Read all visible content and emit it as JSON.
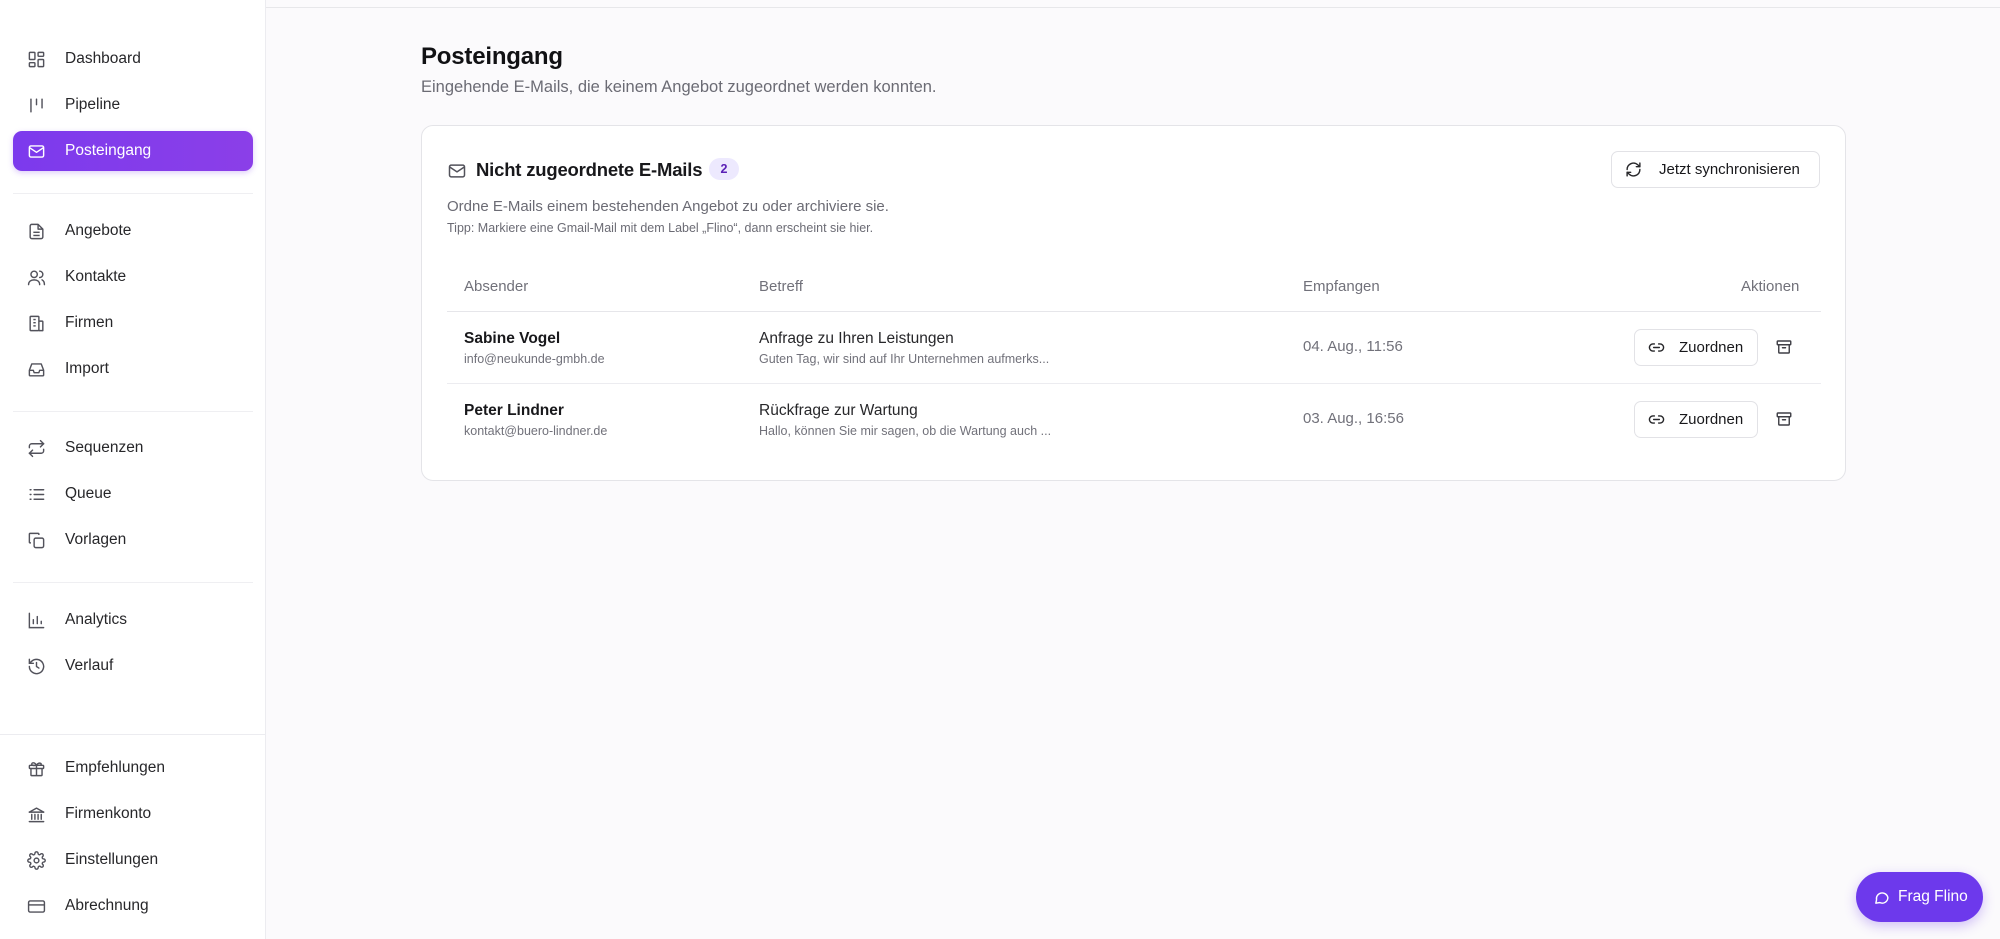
{
  "sidebar": {
    "items": [
      {
        "label": "Dashboard",
        "icon": "dashboard-icon"
      },
      {
        "label": "Pipeline",
        "icon": "pipeline-icon"
      },
      {
        "label": "Posteingang",
        "icon": "mail-icon",
        "active": true
      },
      {
        "label": "Angebote",
        "icon": "document-icon"
      },
      {
        "label": "Kontakte",
        "icon": "users-icon"
      },
      {
        "label": "Firmen",
        "icon": "building-icon"
      },
      {
        "label": "Import",
        "icon": "inbox-icon"
      },
      {
        "label": "Sequenzen",
        "icon": "repeat-icon"
      },
      {
        "label": "Queue",
        "icon": "list-icon"
      },
      {
        "label": "Vorlagen",
        "icon": "copy-icon"
      },
      {
        "label": "Analytics",
        "icon": "chart-icon"
      },
      {
        "label": "Verlauf",
        "icon": "history-icon"
      }
    ],
    "bottom_items": [
      {
        "label": "Empfehlungen",
        "icon": "gift-icon"
      },
      {
        "label": "Firmenkonto",
        "icon": "bank-icon"
      },
      {
        "label": "Einstellungen",
        "icon": "gear-icon"
      },
      {
        "label": "Abrechnung",
        "icon": "credit-card-icon"
      }
    ]
  },
  "page": {
    "title": "Posteingang",
    "subtitle": "Eingehende E-Mails, die keinem Angebot zugeordnet werden konnten."
  },
  "card": {
    "title": "Nicht zugeordnete E-Mails",
    "count": "2",
    "description": "Ordne E-Mails einem bestehenden Angebot zu oder archiviere sie.",
    "tip": "Tipp: Markiere eine Gmail-Mail mit dem Label „Flino“, dann erscheint sie hier.",
    "sync_label": "Jetzt synchronisieren"
  },
  "table": {
    "headers": {
      "sender": "Absender",
      "subject": "Betreff",
      "received": "Empfangen",
      "actions": "Aktionen"
    },
    "rows": [
      {
        "sender_name": "Sabine Vogel",
        "sender_email": "info@neukunde-gmbh.de",
        "subject": "Anfrage zu Ihren Leistungen",
        "preview": "Guten Tag, wir sind auf Ihr Unternehmen aufmerks...",
        "received": "04. Aug., 11:56",
        "assign_label": "Zuordnen"
      },
      {
        "sender_name": "Peter Lindner",
        "sender_email": "kontakt@buero-lindner.de",
        "subject": "Rückfrage zur Wartung",
        "preview": "Hallo, können Sie mir sagen, ob die Wartung auch ...",
        "received": "03. Aug., 16:56",
        "assign_label": "Zuordnen"
      }
    ]
  },
  "chat": {
    "label": "Frag Flino"
  },
  "colors": {
    "accent": "#7c3aed",
    "chat_button": "#6d39ec",
    "badge_bg": "#ede9fe"
  }
}
